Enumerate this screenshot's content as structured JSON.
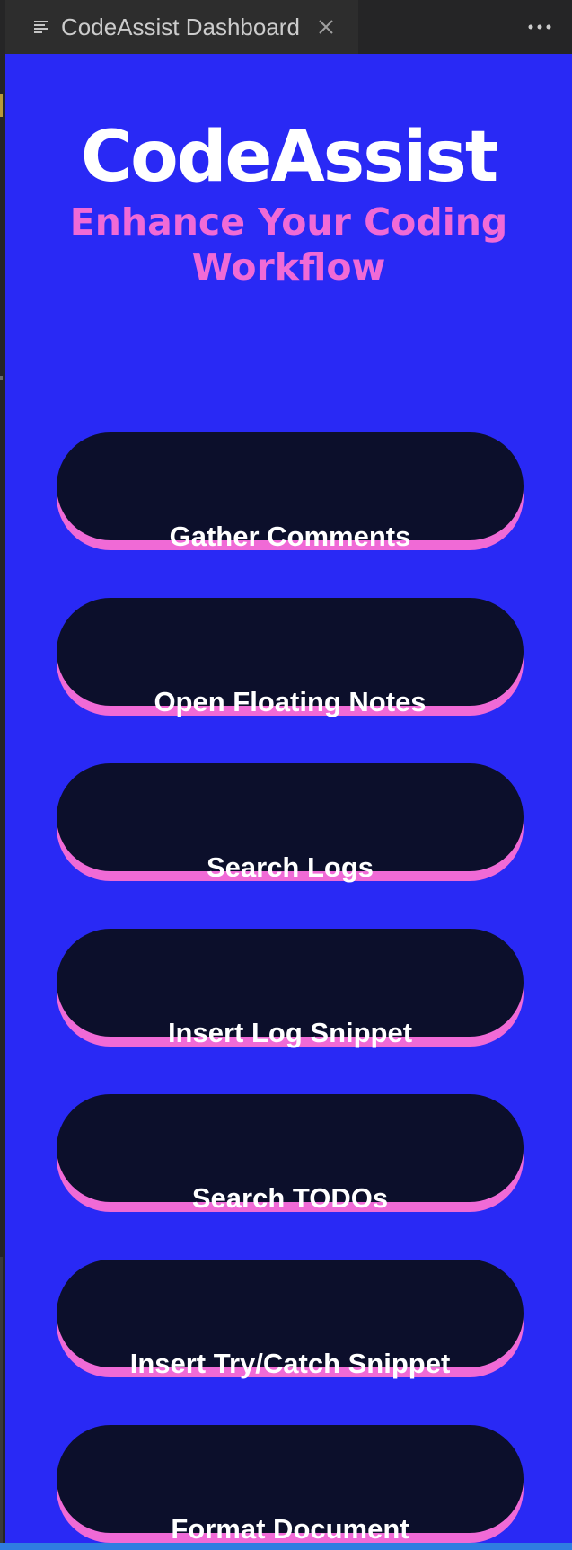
{
  "tab": {
    "title": "CodeAssist Dashboard",
    "icon": "preview-lines-icon",
    "close_icon": "close-icon"
  },
  "toolbar": {
    "more_icon": "ellipsis-icon"
  },
  "hero": {
    "title": "CodeAssist",
    "subtitle": "Enhance Your Coding Workflow"
  },
  "actions": [
    {
      "label": "Gather Comments"
    },
    {
      "label": "Open Floating Notes"
    },
    {
      "label": "Search Logs"
    },
    {
      "label": "Insert Log Snippet"
    },
    {
      "label": "Search TODOs"
    },
    {
      "label": "Insert Try/Catch Snippet"
    },
    {
      "label": "Format Document"
    }
  ],
  "colors": {
    "background": "#2929f5",
    "accent": "#f06ad6",
    "button": "#0c0f2b",
    "title": "#ffffff"
  }
}
